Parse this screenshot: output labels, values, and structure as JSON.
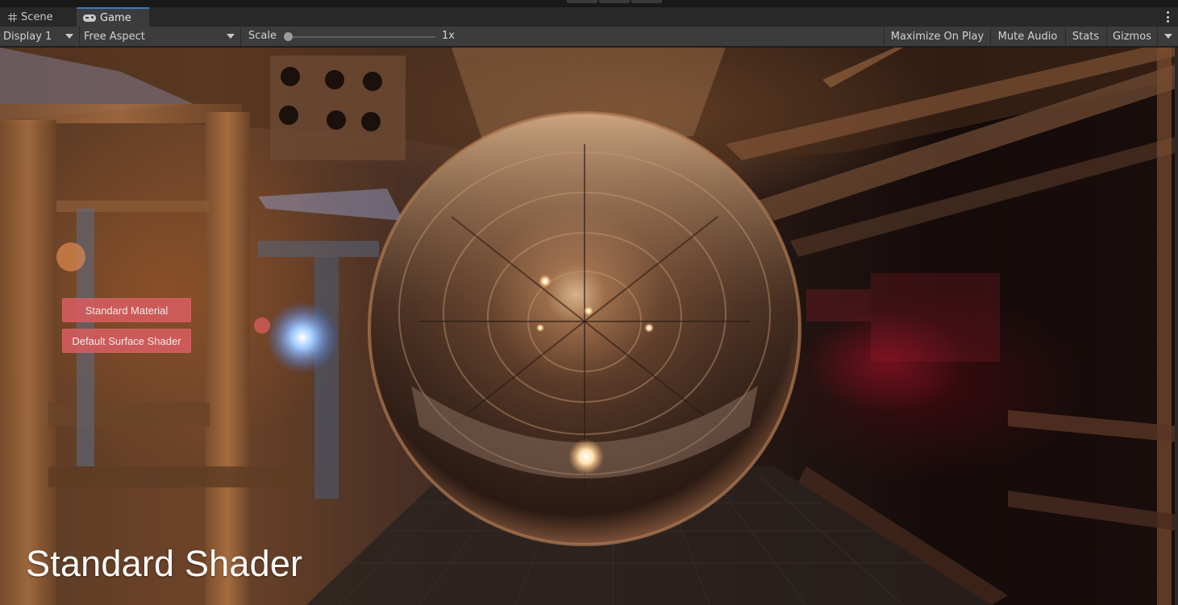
{
  "tabs": [
    {
      "label": "Scene",
      "icon": "grid-icon",
      "active": false
    },
    {
      "label": "Game",
      "icon": "gamepad-icon",
      "active": true
    }
  ],
  "toolbar": {
    "display": "Display 1",
    "aspect": "Free Aspect",
    "scale_label": "Scale",
    "scale_value": "1x",
    "maximize": "Maximize On Play",
    "mute": "Mute Audio",
    "stats": "Stats",
    "gizmos": "Gizmos"
  },
  "game": {
    "buttons": [
      "Standard Material",
      "Default Surface Shader"
    ],
    "title": "Standard Shader"
  },
  "colors": {
    "active_tab_accent": "#3a79bb",
    "ui_button": "#d65c60"
  }
}
